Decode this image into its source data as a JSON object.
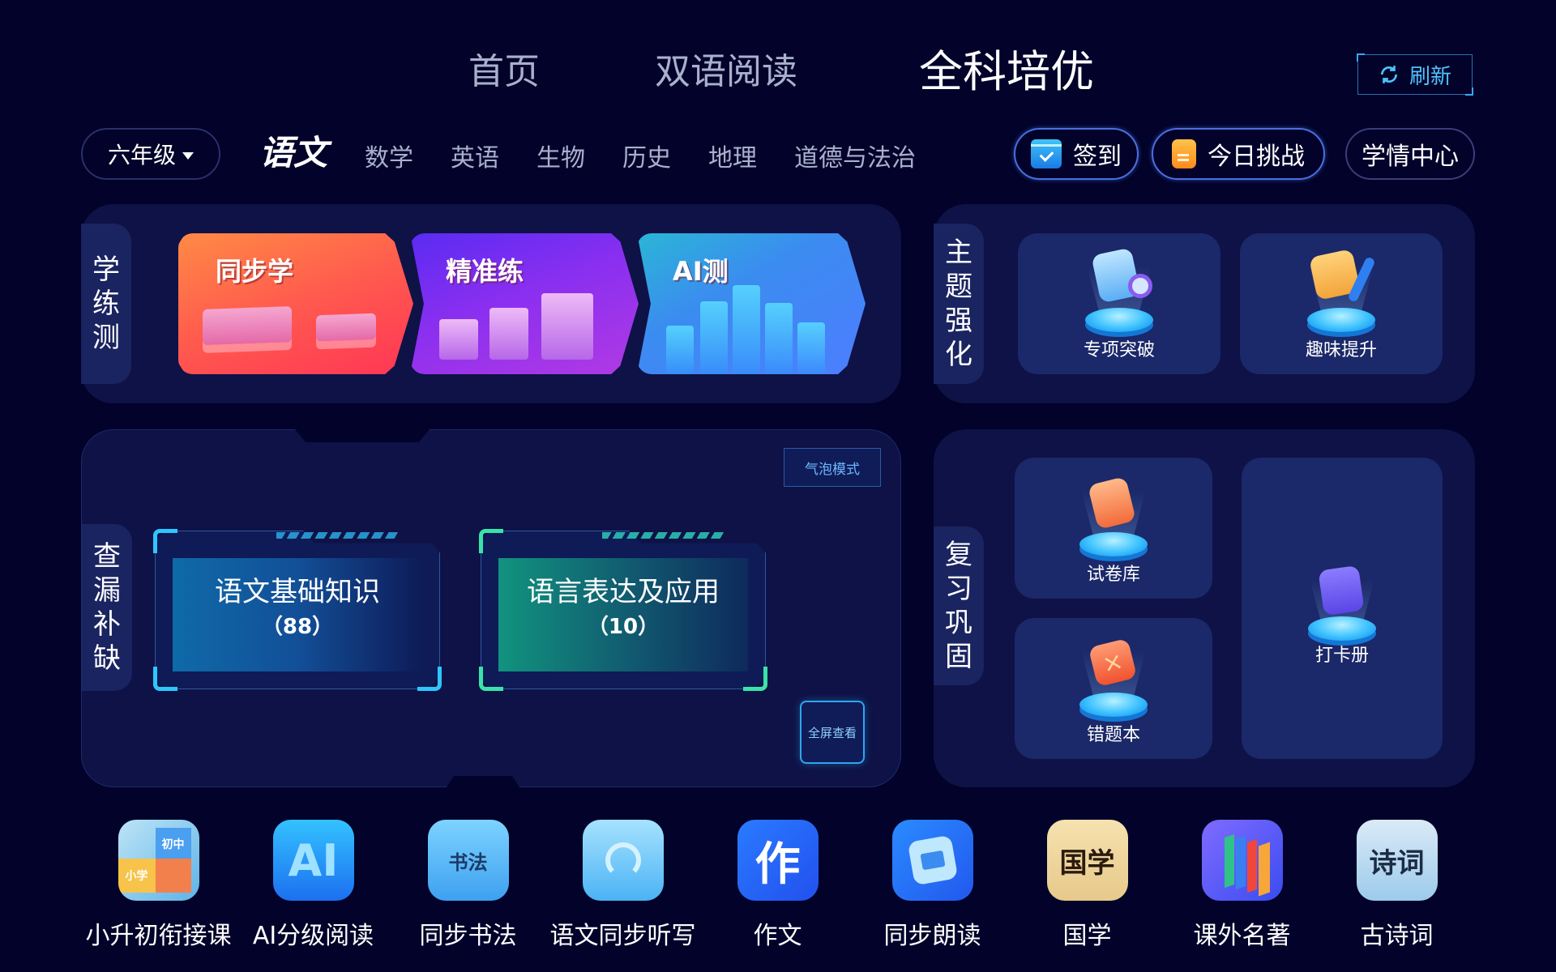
{
  "top_nav": {
    "tabs": [
      {
        "label": "首页",
        "active": false
      },
      {
        "label": "双语阅读",
        "active": false
      },
      {
        "label": "全科培优",
        "active": true
      }
    ],
    "refresh_label": "刷新"
  },
  "grade_selector": {
    "value": "六年级"
  },
  "subjects": [
    {
      "label": "语文",
      "active": true
    },
    {
      "label": "数学",
      "active": false
    },
    {
      "label": "英语",
      "active": false
    },
    {
      "label": "生物",
      "active": false
    },
    {
      "label": "历史",
      "active": false
    },
    {
      "label": "地理",
      "active": false
    },
    {
      "label": "道德与法治",
      "active": false
    }
  ],
  "actions": {
    "signin": "签到",
    "challenge": "今日挑战",
    "report": "学情中心"
  },
  "sections": {
    "learn_practice_test": {
      "label": [
        "学",
        "练",
        "测"
      ],
      "cards": [
        {
          "title": "同步学"
        },
        {
          "title": "精准练"
        },
        {
          "title": "AI测"
        }
      ]
    },
    "topic_strengthen": {
      "label": [
        "主",
        "题",
        "强",
        "化"
      ],
      "items": [
        {
          "label": "专项突破"
        },
        {
          "label": "趣味提升"
        }
      ]
    },
    "fill_gaps": {
      "label": [
        "查",
        "漏",
        "补",
        "缺"
      ],
      "bubble_mode": "气泡模式",
      "fullscreen": "全屏查看",
      "cards": [
        {
          "name": "语文基础知识",
          "count": "（88）",
          "color": "#2ec6ff"
        },
        {
          "name": "语言表达及应用",
          "count": "（10）",
          "color": "#3ae3a8"
        }
      ]
    },
    "review": {
      "label": [
        "复",
        "习",
        "巩",
        "固"
      ],
      "items": [
        {
          "label": "试卷库"
        },
        {
          "label": "错题本"
        },
        {
          "label": "打卡册"
        }
      ]
    }
  },
  "apps": [
    {
      "label": "小升初衔接课",
      "icon_text": "初中 小学"
    },
    {
      "label": "AI分级阅读",
      "icon_text": "AI"
    },
    {
      "label": "同步书法",
      "icon_text": "书法"
    },
    {
      "label": "语文同步听写",
      "icon_text": ""
    },
    {
      "label": "作文",
      "icon_text": "作"
    },
    {
      "label": "同步朗读",
      "icon_text": ""
    },
    {
      "label": "国学",
      "icon_text": "国学"
    },
    {
      "label": "课外名著",
      "icon_text": ""
    },
    {
      "label": "古诗词",
      "icon_text": "诗词"
    }
  ]
}
